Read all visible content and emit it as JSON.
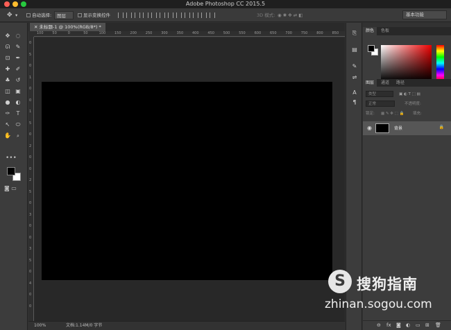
{
  "window": {
    "title": "Adobe Photoshop CC 2015.5"
  },
  "options_bar": {
    "auto_select_label": "自动选择:",
    "auto_select_value": "图层",
    "show_transform_label": "显示变换控件",
    "mode_3d_label": "3D 模式:",
    "workspace": "基本功能"
  },
  "tools": {
    "icons": [
      "move-icon",
      "marquee-icon",
      "lasso-icon",
      "magic-wand-icon",
      "crop-icon",
      "eyedropper-icon",
      "healing-brush-icon",
      "brush-icon",
      "stamp-icon",
      "history-brush-icon",
      "eraser-icon",
      "gradient-icon",
      "blur-icon",
      "dodge-icon",
      "pen-icon",
      "type-icon",
      "path-select-icon",
      "shape-icon",
      "hand-icon",
      "zoom-icon"
    ],
    "glyphs": [
      "✥",
      "◌",
      "ᘏ",
      "✎",
      "⊡",
      "✒",
      "✚",
      "✐",
      "♣",
      "↺",
      "◫",
      "▣",
      "●",
      "◐",
      "✑",
      "T",
      "↖",
      "⬭",
      "✋",
      "🔍"
    ],
    "more": "•••",
    "foreground_color": "#000000",
    "background_color": "#ffffff"
  },
  "document": {
    "tab_label": "未标题-1 @ 100%(RGB/8*) *",
    "ruler_h_ticks": [
      "100",
      "50",
      "0",
      "50",
      "100",
      "150",
      "200",
      "250",
      "300",
      "350",
      "400",
      "450",
      "500",
      "550",
      "600",
      "650",
      "700",
      "750",
      "800",
      "850"
    ],
    "ruler_v_ticks": [
      "0",
      "5",
      "0",
      "1",
      "0",
      "0",
      "1",
      "5",
      "0",
      "2",
      "0",
      "0",
      "2",
      "5",
      "0",
      "3",
      "0",
      "0",
      "3",
      "5",
      "0",
      "4",
      "0",
      "0"
    ],
    "canvas_color": "#000000"
  },
  "status": {
    "zoom": "100%",
    "doc_info": "文档:1.14M/0 字节"
  },
  "panels": {
    "color_tabs": [
      "颜色",
      "色板"
    ],
    "layers_tabs": [
      "图层",
      "通道",
      "路径"
    ],
    "kind_label": "类型",
    "blend_mode": "正常",
    "opacity_label": "不透明度:",
    "lock_label": "锁定:",
    "fill_label": "填充:",
    "layer_name": "背景"
  },
  "watermark": {
    "logo_letter": "S",
    "brand": "搜狗指南",
    "url": "zhinan.sogou.com"
  }
}
